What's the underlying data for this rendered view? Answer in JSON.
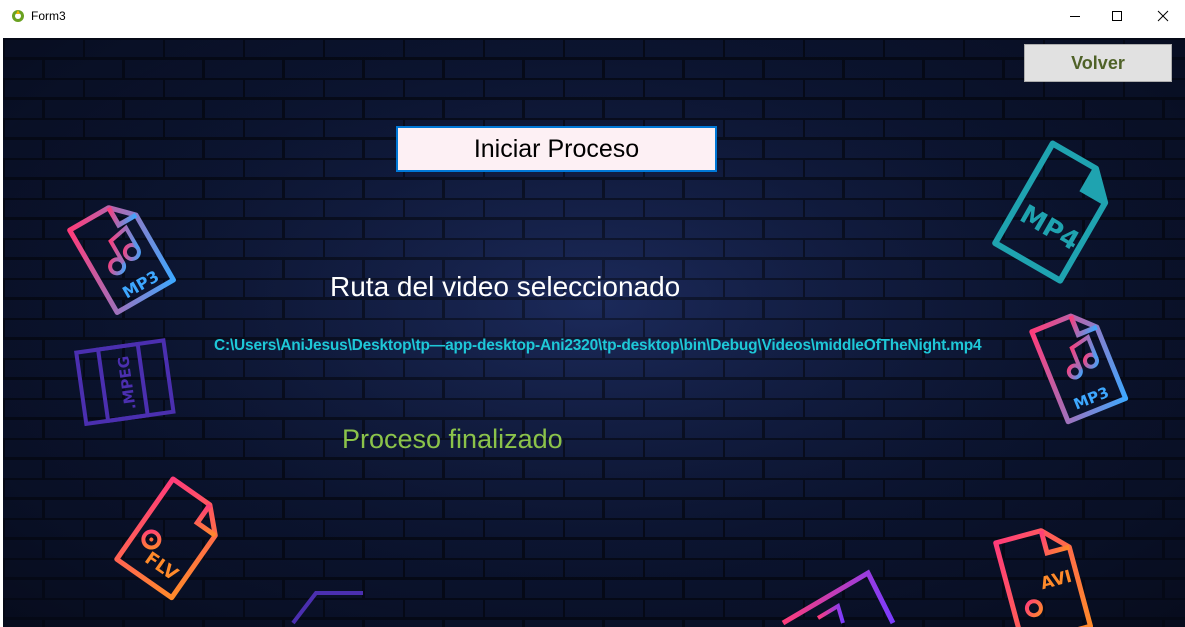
{
  "window": {
    "title": "Form3",
    "controls": {
      "minimize": "minimize-icon",
      "maximize": "maximize-icon",
      "close": "close-icon"
    }
  },
  "form": {
    "back_button": "Volver",
    "start_button": "Iniciar Proceso",
    "path_label": "Ruta del video seleccionado",
    "path_value": "C:\\Users\\AniJesus\\Desktop\\tp—app-desktop-Ani2320\\tp-desktop\\bin\\Debug\\Videos\\middleOfTheNight.mp4",
    "status_label": "Proceso finalizado"
  },
  "decorations": {
    "mp3_left": "MP3",
    "mp4_right": "MP4",
    "mpeg_left": ".MPEG",
    "mp3_right": "MP3",
    "flv_left": "FLV",
    "avi_right": "AVI"
  },
  "colors": {
    "background": "#0b1430",
    "path_text": "#1ec8d8",
    "status_text": "#8bc34a",
    "back_text": "#4f6228",
    "start_border": "#0078d7"
  }
}
